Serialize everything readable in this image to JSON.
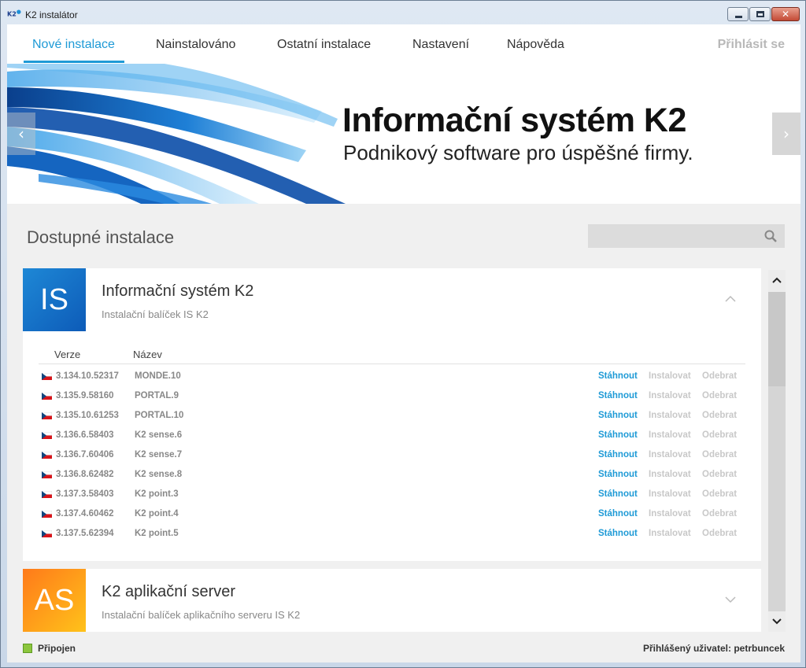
{
  "window": {
    "title": "K2 instalátor",
    "logo": "K2",
    "close_glyph": "✕"
  },
  "nav": {
    "tabs": [
      {
        "label": "Nové instalace",
        "active": true
      },
      {
        "label": "Nainstalováno"
      },
      {
        "label": "Ostatní instalace"
      },
      {
        "label": "Nastavení"
      },
      {
        "label": "Nápověda"
      }
    ],
    "login": "Přihlásit se"
  },
  "banner": {
    "title": "Informační systém K2",
    "subtitle": "Podnikový software pro úspěšné firmy.",
    "prev": "‹",
    "next": "›"
  },
  "available": {
    "title": "Dostupné instalace",
    "search_placeholder": "",
    "search_icon": "search-icon"
  },
  "packages": [
    {
      "tile": "IS",
      "title": "Informační systém K2",
      "subtitle": "Instalační balíček IS K2",
      "expanded": true,
      "columns": {
        "version": "Verze",
        "name": "Název"
      },
      "actions": {
        "download": "Stáhnout",
        "install": "Instalovat",
        "remove": "Odebrat"
      },
      "rows": [
        {
          "version": "3.134.10.52317",
          "name": "MONDE.10"
        },
        {
          "version": "3.135.9.58160",
          "name": "PORTAL.9"
        },
        {
          "version": "3.135.10.61253",
          "name": "PORTAL.10"
        },
        {
          "version": "3.136.6.58403",
          "name": "K2 sense.6"
        },
        {
          "version": "3.136.7.60406",
          "name": "K2 sense.7"
        },
        {
          "version": "3.136.8.62482",
          "name": "K2 sense.8"
        },
        {
          "version": "3.137.3.58403",
          "name": "K2 point.3"
        },
        {
          "version": "3.137.4.60462",
          "name": "K2 point.4"
        },
        {
          "version": "3.137.5.62394",
          "name": "K2 point.5"
        }
      ]
    },
    {
      "tile": "AS",
      "title": "K2 aplikační server",
      "subtitle": "Instalační balíček aplikačního serveru IS K2",
      "expanded": false
    }
  ],
  "status": {
    "connection": "Připojen",
    "user": "Přihlášený uživatel: petrbuncek"
  },
  "colors": {
    "accent": "#1e9ad6",
    "connected": "#8cc63e",
    "tile_is": "#1670c8",
    "tile_as": "#ff9f1a"
  }
}
